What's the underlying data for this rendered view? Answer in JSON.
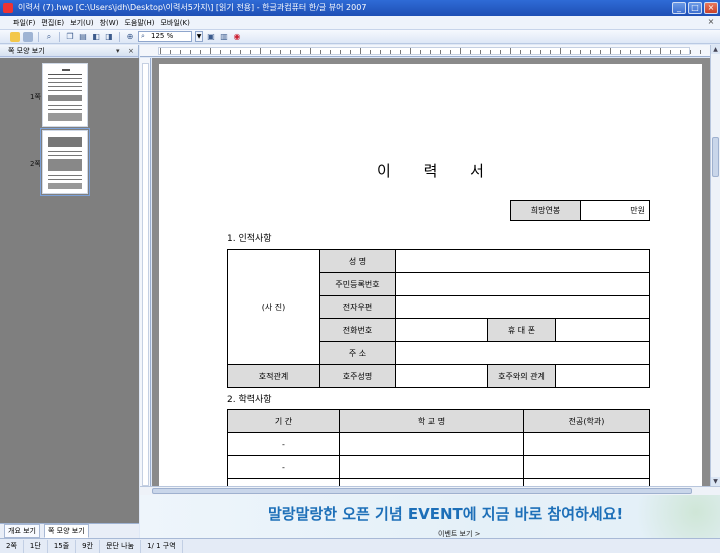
{
  "window": {
    "title": "이력서 (7).hwp [C:\\Users\\jdh\\Desktop\\이력서5가지\\] [읽기 전용] - 한글과컴퓨터 한/글 뷰어 2007",
    "buttons": [
      "_",
      "□",
      "×"
    ]
  },
  "menu": {
    "items": [
      "파일(F)",
      "편집(E)",
      "보기(U)",
      "창(W)",
      "도움말(H)",
      "모바일(K)"
    ],
    "close": "×"
  },
  "toolbar": {
    "zoom": "125 %",
    "icons": [
      "open-icon",
      "print-icon",
      "find-icon",
      "copy-icon",
      "page-view-icon",
      "zoom-icon",
      "pdf-icon"
    ]
  },
  "left_panel": {
    "title": "쪽 모양 보기",
    "pages": [
      "1쪽",
      "2쪽"
    ],
    "tabs": [
      "개요 보기",
      "쪽 모양 보기"
    ]
  },
  "document": {
    "title": "이 력 서",
    "salary": {
      "label": "희망연봉",
      "unit": "만원"
    },
    "section1": "1. 인적사항",
    "photo": "(사 진)",
    "personal": {
      "name": "성  명",
      "rrn": "주민등록번호",
      "email": "전자우편",
      "phone": "전화번호",
      "mobile": "휴 대 폰",
      "address": "주  소",
      "family": "호적관계",
      "head_name": "호주성명",
      "head_relation": "호주와의 관계"
    },
    "section2": "2. 학력사항",
    "education_headers": [
      "기    간",
      "학 교 명",
      "전공(학과)"
    ],
    "education_rows": [
      "-",
      "-",
      "-"
    ]
  },
  "banner": {
    "text_before": "말랑말랑한 오픈 기념 ",
    "text_em": "EVENT",
    "text_after": "에 지금 바로 참여하세요!",
    "link": "이벤트 보기 >"
  },
  "status": [
    "2쪽",
    "1단",
    "15줄",
    "9칸",
    "문단 나눔",
    "1/ 1 구역"
  ]
}
